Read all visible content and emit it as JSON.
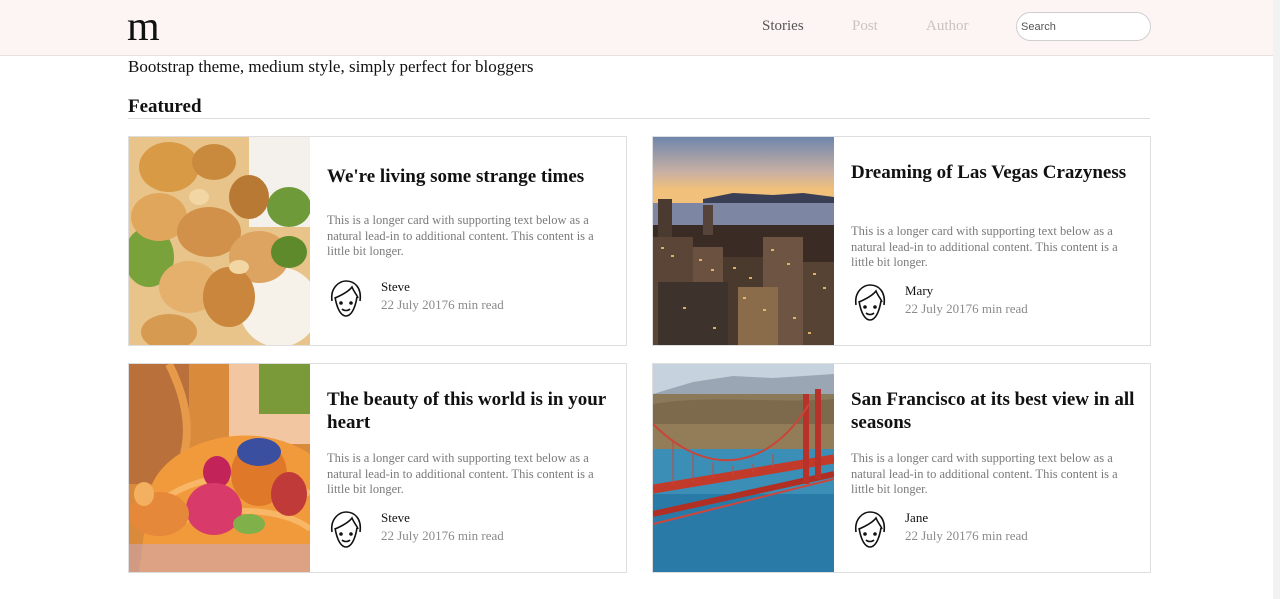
{
  "navbar": {
    "brand": "m",
    "links": [
      {
        "label": "Stories"
      },
      {
        "label": "Post"
      },
      {
        "label": "Author"
      }
    ],
    "search_placeholder": "Search"
  },
  "header": {
    "tagline": "Bootstrap theme, medium style, simply perfect for bloggers"
  },
  "featured": {
    "title": "Featured",
    "cards": [
      {
        "title": "We're living some strange times",
        "text": "This is a longer card with supporting text below as a natural lead-in to additional content. This content is a little bit longer.",
        "author": "Steve",
        "meta": "22 July 20176 min read",
        "image": "chicken-salad-photo"
      },
      {
        "title": "Dreaming of Las Vegas Crazyness",
        "text": "This is a longer card with supporting text below as a natural lead-in to additional content. This content is a little bit longer.",
        "author": "Mary",
        "meta": "22 July 20176 min read",
        "image": "city-skyline-photo"
      },
      {
        "title": "The beauty of this world is in your heart",
        "text": "This is a longer card with supporting text below as a natural lead-in to additional content. This content is a little bit longer.",
        "author": "Steve",
        "meta": "22 July 20176 min read",
        "image": "easter-eggs-basket-photo"
      },
      {
        "title": "San Francisco at its best view in all seasons",
        "text": "This is a longer card with supporting text below as a natural lead-in to additional content. This content is a little bit longer.",
        "author": "Jane",
        "meta": "22 July 20176 min read",
        "image": "golden-gate-bridge-photo"
      }
    ]
  },
  "colors": {
    "navbar_bg": "#fdf5f4",
    "muted_text": "#7a7a7a",
    "nav_muted": "#c9c3c2",
    "border": "#dedede"
  },
  "icons": {
    "avatar": "face-outline-icon"
  }
}
